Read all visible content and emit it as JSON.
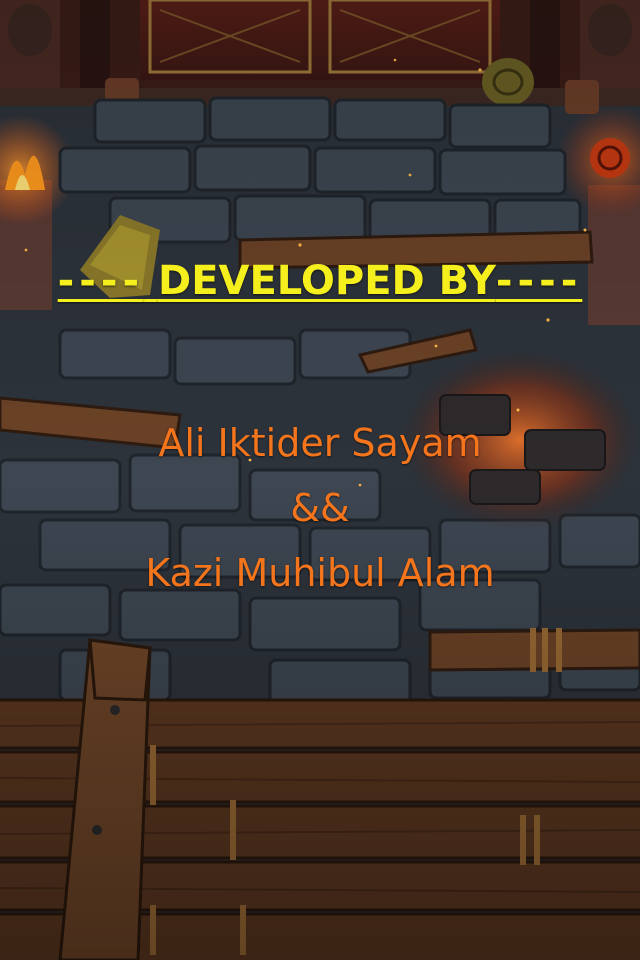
{
  "screen": {
    "name": "credits",
    "colors": {
      "heading": "#f5ef1d",
      "names": "#f5751c",
      "stone": "#3d4651",
      "wood": "#6b4226",
      "fire": "#e8571b"
    }
  },
  "heading": {
    "left_dashes": "----",
    "text": "DEVELOPED BY",
    "right_dashes": "----"
  },
  "developers": {
    "first": "Ali Iktider Sayam",
    "separator": "&&",
    "second": "Kazi Muhibul Alam"
  }
}
